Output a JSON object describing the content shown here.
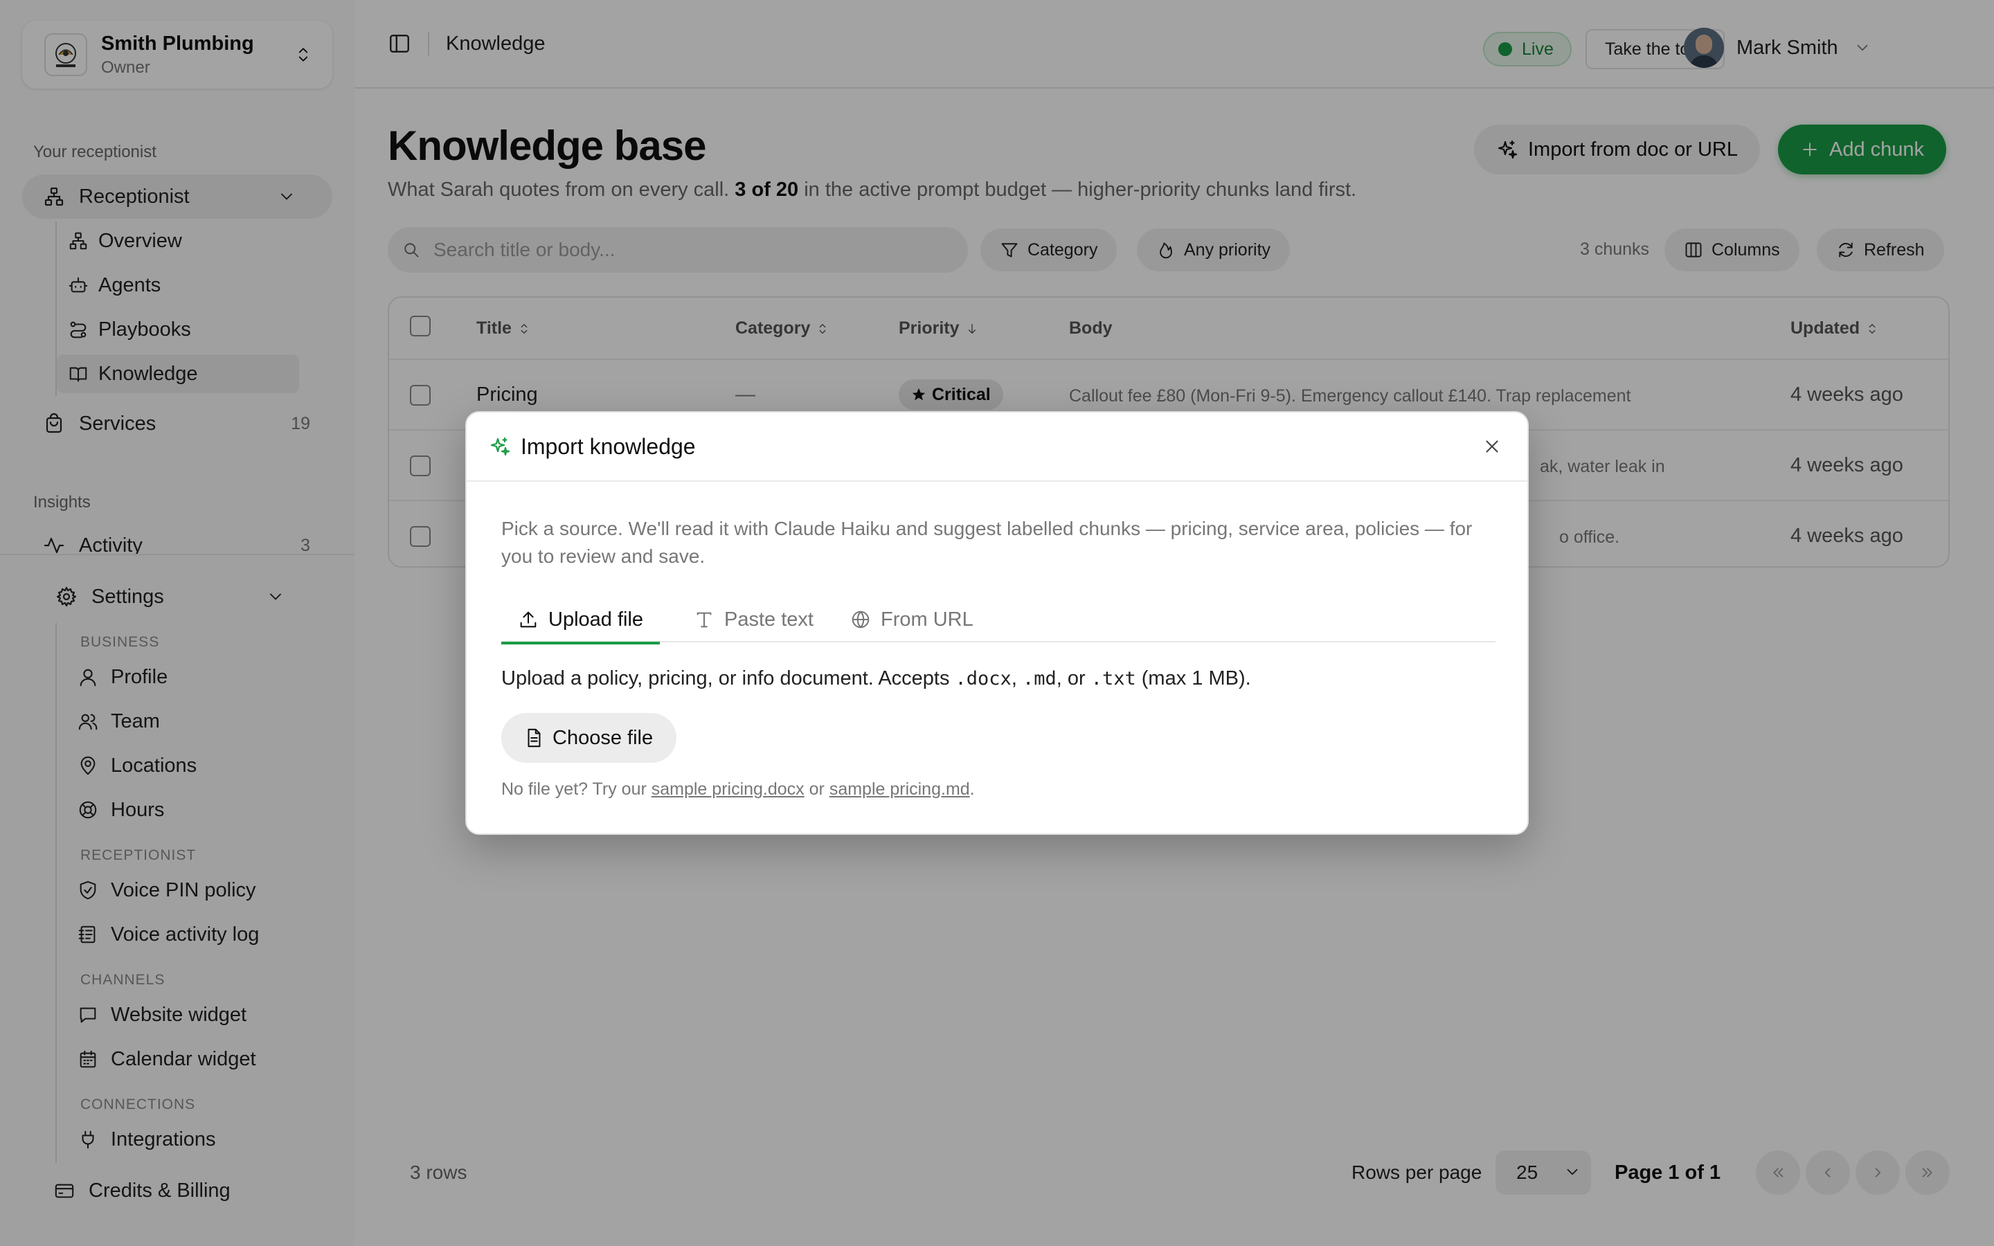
{
  "org": {
    "name": "Smith Plumbing",
    "role": "Owner"
  },
  "sidebar": {
    "section_receptionist": "Your receptionist",
    "receptionist": {
      "label": "Receptionist"
    },
    "sub_items": [
      {
        "label": "Overview",
        "icon": "sitemap-icon"
      },
      {
        "label": "Agents",
        "icon": "bot-icon"
      },
      {
        "label": "Playbooks",
        "icon": "route-icon"
      },
      {
        "label": "Knowledge",
        "icon": "book-icon"
      }
    ],
    "services": {
      "label": "Services",
      "count": "19"
    },
    "section_insights": "Insights",
    "activity": {
      "label": "Activity",
      "count": "3"
    },
    "settings": {
      "label": "Settings",
      "group_business": "BUSINESS",
      "business": [
        "Profile",
        "Team",
        "Locations",
        "Hours"
      ],
      "group_receptionist": "RECEPTIONIST",
      "receptionist": [
        "Voice PIN policy",
        "Voice activity log"
      ],
      "group_channels": "CHANNELS",
      "channels": [
        "Website widget",
        "Calendar widget"
      ],
      "group_connections": "CONNECTIONS",
      "connections": [
        "Integrations"
      ]
    },
    "billing": "Credits & Billing"
  },
  "header": {
    "breadcrumb": "Knowledge",
    "live_label": "Live",
    "tour_label": "Take the tour",
    "user_name": "Mark Smith"
  },
  "page": {
    "title": "Knowledge base",
    "lead_pre": "What Sarah quotes from on every call. ",
    "lead_bold": "3 of 20",
    "lead_post": " in the active prompt budget — higher-priority chunks land first.",
    "import_label": "Import from doc or URL",
    "add_label": "Add chunk",
    "search_placeholder": "Search title or body...",
    "filter_category": "Category",
    "filter_priority": "Any priority",
    "chunk_count": "3 chunks",
    "columns_label": "Columns",
    "refresh_label": "Refresh"
  },
  "table": {
    "headers": {
      "title": "Title",
      "category": "Category",
      "priority": "Priority",
      "body": "Body",
      "updated": "Updated"
    },
    "rows": [
      {
        "title": "Pricing",
        "category": "—",
        "priority": "Critical",
        "body": "Callout fee £80 (Mon-Fri 9-5). Emergency callout £140. Trap replacement",
        "updated": "4 weeks ago"
      },
      {
        "title": "",
        "category": "",
        "priority": "",
        "body": "ak, water leak in",
        "updated": "4 weeks ago"
      },
      {
        "title": "",
        "category": "",
        "priority": "",
        "body": "o office.",
        "updated": "4 weeks ago"
      }
    ]
  },
  "footer": {
    "rows_label": "3 rows",
    "rows_per_page_label": "Rows per page",
    "rows_per_page_value": "25",
    "page_info": "Page 1 of 1"
  },
  "modal": {
    "title": "Import knowledge",
    "description": "Pick a source. We'll read it with Claude Haiku and suggest labelled chunks — pricing, service area, policies — for you to review and save.",
    "tabs": [
      "Upload file",
      "Paste text",
      "From URL"
    ],
    "upload_pre": "Upload a policy, pricing, or info document. Accepts ",
    "ext_docx": ".docx",
    "ext_md": ".md",
    "ext_txt": ".txt",
    "upload_post": " (max 1 MB).",
    "choose_label": "Choose file",
    "hint_pre": "No file yet? Try our ",
    "hint_link1": "sample pricing.docx",
    "hint_mid": " or ",
    "hint_link2": "sample pricing.md",
    "hint_post": "."
  },
  "colors": {
    "accent": "#1a9c45",
    "overlay": "rgba(0,0,0,0.36)"
  }
}
